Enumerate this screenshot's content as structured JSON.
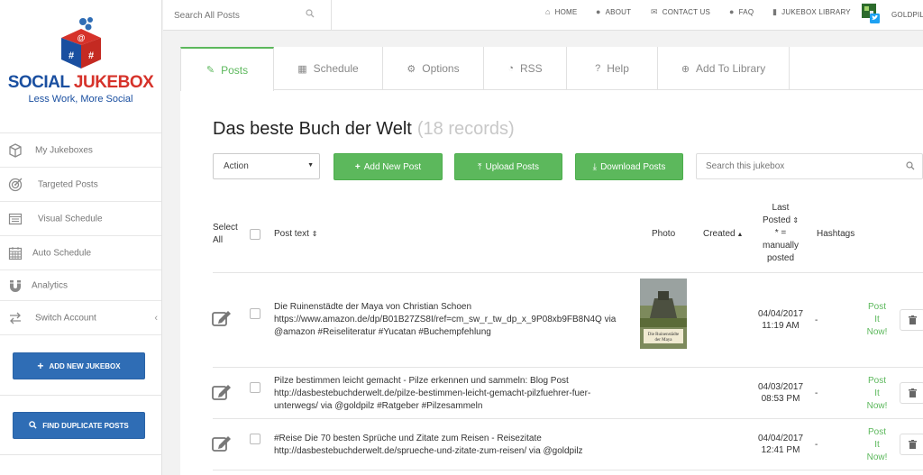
{
  "brand": {
    "name_part1": "SOCIAL ",
    "name_part2": "JUKEBOX",
    "tagline": "Less Work, More Social"
  },
  "sidebar": {
    "items": [
      {
        "label": "My Jukeboxes",
        "icon": "cube-icon"
      },
      {
        "label": "Targeted Posts",
        "icon": "target-icon"
      },
      {
        "label": "Visual Schedule",
        "icon": "calendar-list-icon"
      },
      {
        "label": "Auto Schedule",
        "icon": "calendar-grid-icon"
      },
      {
        "label": "Analytics",
        "icon": "magnet-icon"
      },
      {
        "label": "Switch Account",
        "icon": "switch-arrows-icon"
      }
    ],
    "add_jukebox_label": "ADD NEW JUKEBOX",
    "find_duplicates_label": "FIND DUPLICATE POSTS"
  },
  "topbar": {
    "search_placeholder": "Search All Posts",
    "nav": {
      "home": "HOME",
      "about": "ABOUT",
      "contact": "CONTACT US",
      "faq": "FAQ",
      "library": "JUKEBOX LIBRARY",
      "user": "GOLDPIL"
    }
  },
  "tabs": {
    "posts": "Posts",
    "schedule": "Schedule",
    "options": "Options",
    "rss": "RSS",
    "help": "Help",
    "add_library": "Add To Library"
  },
  "page": {
    "title": "Das beste Buch der Welt",
    "record_count": "(18 records)"
  },
  "toolbar": {
    "action_label": "Action",
    "add_post": "Add New Post",
    "upload": "Upload Posts",
    "download": "Download Posts",
    "search_placeholder": "Search this jukebox"
  },
  "table": {
    "headers": {
      "select_all": "Select All",
      "post_text": "Post text",
      "photo": "Photo",
      "created": "Created",
      "last_posted_1": "Last",
      "last_posted_2": "Posted",
      "last_posted_3": "* =",
      "last_posted_4": "manually",
      "last_posted_5": "posted",
      "hashtags": "Hashtags"
    },
    "rows": [
      {
        "text_line1": "Die Ruinenstädte der Maya von Christian Schoen",
        "text_line2": "https://www.amazon.de/dp/B01B27ZS8I/ref=cm_sw_r_tw_dp_x_9P08xb9FB8N4Q via",
        "text_line3": "@amazon #Reiseliteratur #Yucatan #Buchempfehlung",
        "date": "04/04/2017",
        "time": "11:19 AM",
        "hashtags": "-",
        "post1": "Post",
        "post2": "It",
        "post3": "Now!"
      },
      {
        "text_line1": "Pilze bestimmen leicht gemacht - Pilze erkennen und sammeln: Blog Post",
        "text_line2": "http://dasbestebuchderwelt.de/pilze-bestimmen-leicht-gemacht-pilzfuehrer-fuer-",
        "text_line3": "unterwegs/ via @goldpilz #Ratgeber #Pilzesammeln",
        "date": "04/03/2017",
        "time": "08:53 PM",
        "hashtags": "-",
        "post1": "Post",
        "post2": "It",
        "post3": "Now!"
      },
      {
        "text_line1": "#Reise Die 70 besten Sprüche und Zitate zum Reisen - Reisezitate",
        "text_line2": "http://dasbestebuchderwelt.de/sprueche-und-zitate-zum-reisen/ via @goldpilz",
        "text_line3": "",
        "date": "04/04/2017",
        "time": "12:41 PM",
        "hashtags": "-",
        "post1": "Post",
        "post2": "It",
        "post3": "Now!"
      }
    ]
  },
  "book_cover": {
    "title_1": "Die Ruinenstädte",
    "title_2": "der Maya"
  },
  "colors": {
    "green": "#5cb85c",
    "blue": "#2f6db5",
    "brand_red": "#d6322a",
    "brand_blue": "#1a4fa0"
  }
}
